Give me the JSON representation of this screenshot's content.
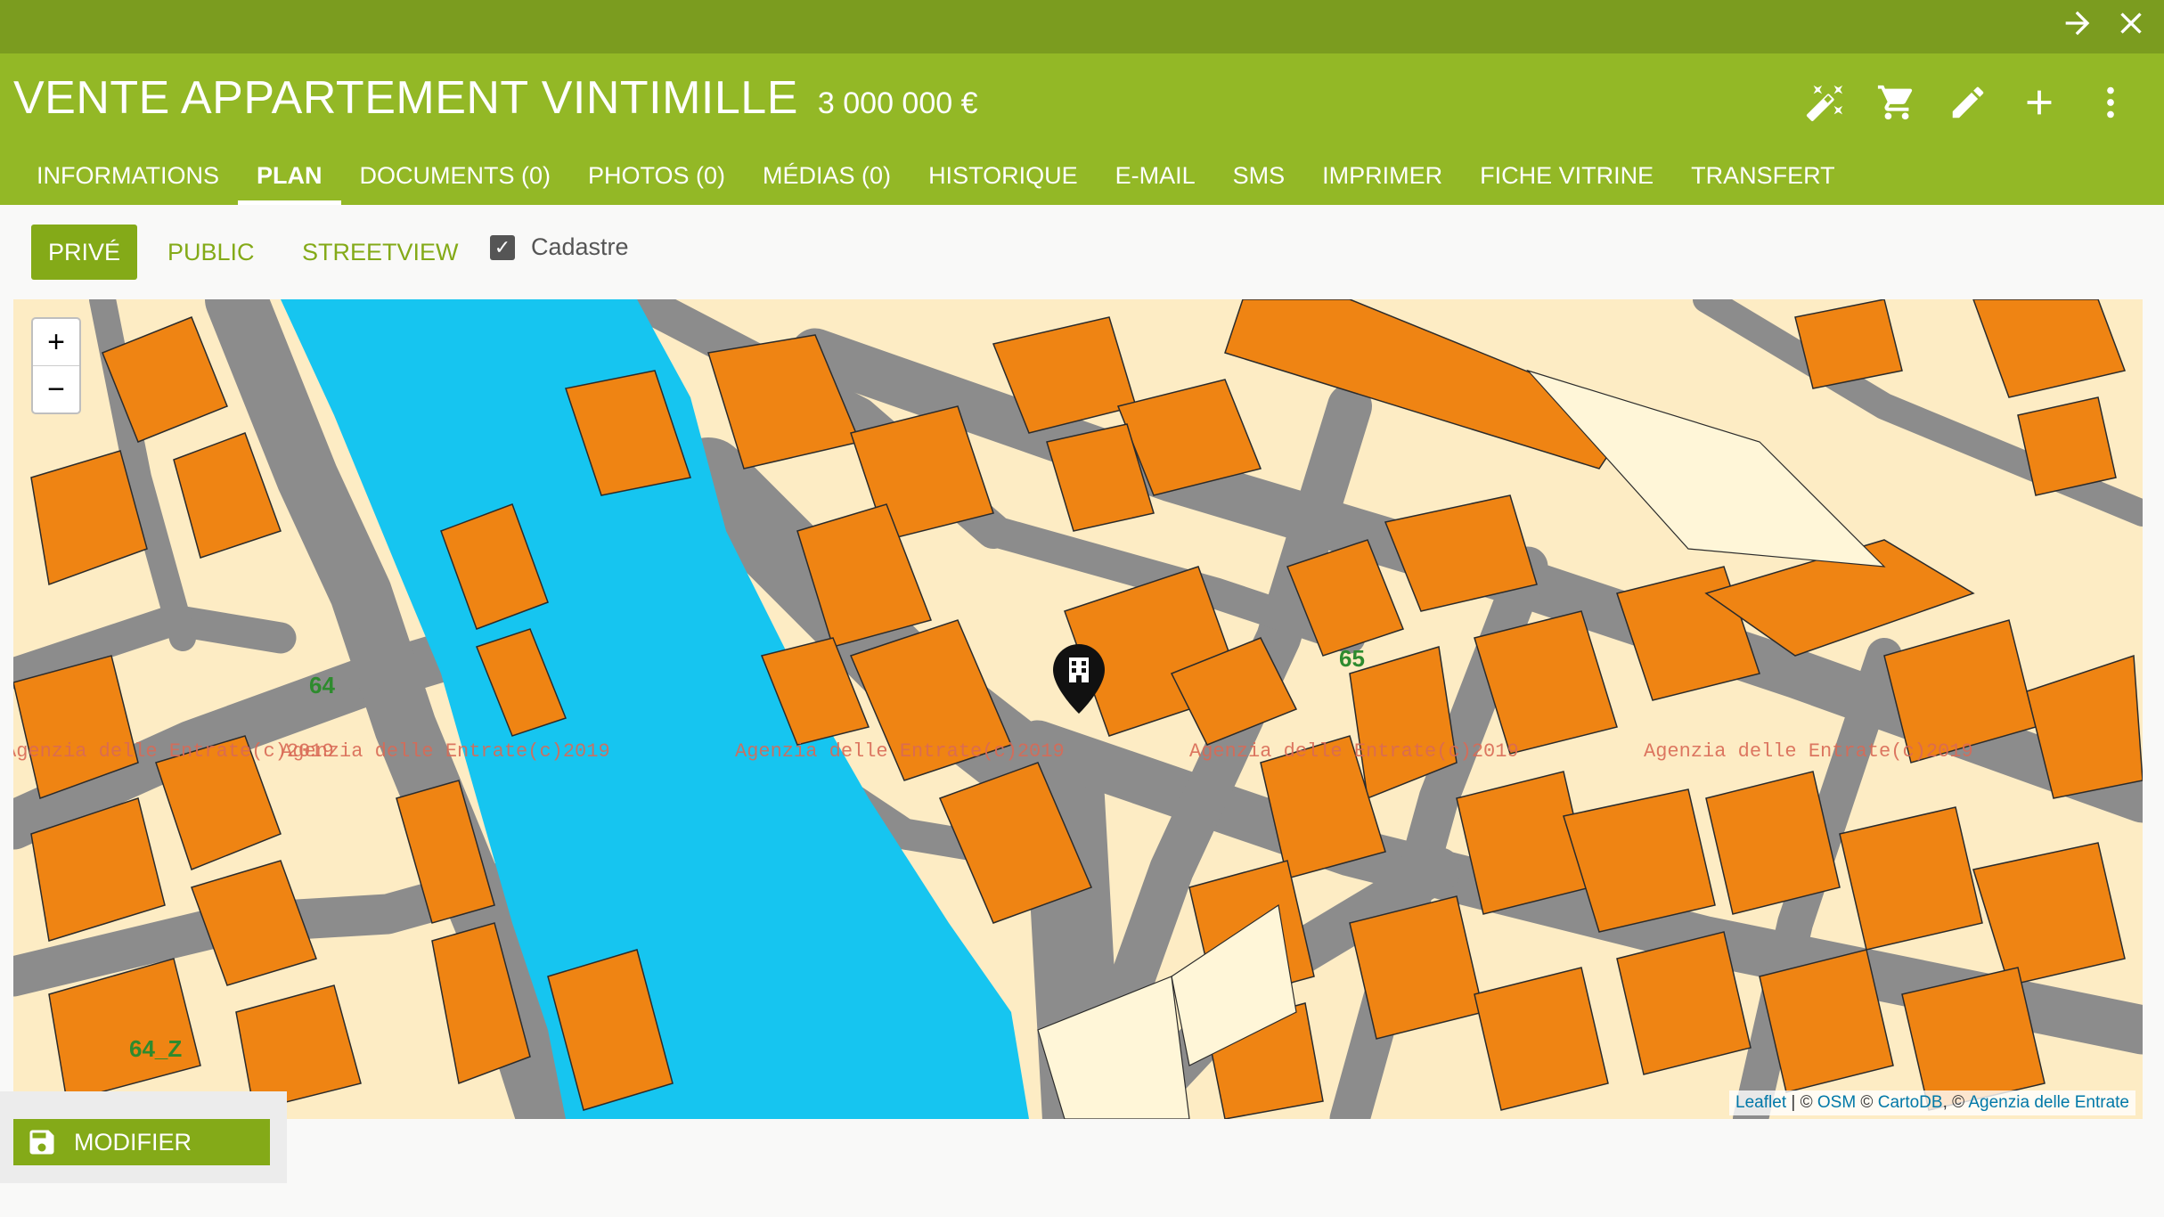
{
  "window": {
    "forward_icon": "arrow-right-icon",
    "close_icon": "close-icon"
  },
  "header": {
    "title": "VENTE APPARTEMENT VINTIMILLE",
    "price": "3 000 000 €",
    "actions": [
      "magic-wand-icon",
      "cart-icon",
      "pencil-icon",
      "plus-icon",
      "more-vertical-icon"
    ]
  },
  "tabs": [
    {
      "label": "INFORMATIONS",
      "active": false
    },
    {
      "label": "PLAN",
      "active": true
    },
    {
      "label": "DOCUMENTS (0)",
      "active": false
    },
    {
      "label": "PHOTOS (0)",
      "active": false
    },
    {
      "label": "MÉDIAS (0)",
      "active": false
    },
    {
      "label": "HISTORIQUE",
      "active": false
    },
    {
      "label": "E-MAIL",
      "active": false
    },
    {
      "label": "SMS",
      "active": false
    },
    {
      "label": "IMPRIMER",
      "active": false
    },
    {
      "label": "FICHE VITRINE",
      "active": false
    },
    {
      "label": "TRANSFERT",
      "active": false
    }
  ],
  "map_view": {
    "prive": "PRIVÉ",
    "public": "PUBLIC",
    "streetview": "STREETVIEW",
    "cadastre_label": "Cadastre",
    "cadastre_checked": true,
    "active": "PRIVÉ"
  },
  "map": {
    "zoom_in": "+",
    "zoom_out": "−",
    "watermark": "Agenzia delle Entrate(c)2019",
    "grid_labels": [
      "64",
      "65",
      "64_Z"
    ],
    "attribution": {
      "leaflet": "Leaflet",
      "sep1": " | © ",
      "osm": "OSM",
      "sep2": " © ",
      "cartodb": "CartoDB",
      "sep3": ", © ",
      "agenzia": "Agenzia delle Entrate"
    },
    "colors": {
      "land": "#fdecc4",
      "building": "#ef8413",
      "road": "#8c8c8c",
      "water": "#16c5f0"
    },
    "marker_icon": "building-marker-icon"
  },
  "footer": {
    "modifier_label": "MODIFIER",
    "save_icon": "save-icon"
  }
}
